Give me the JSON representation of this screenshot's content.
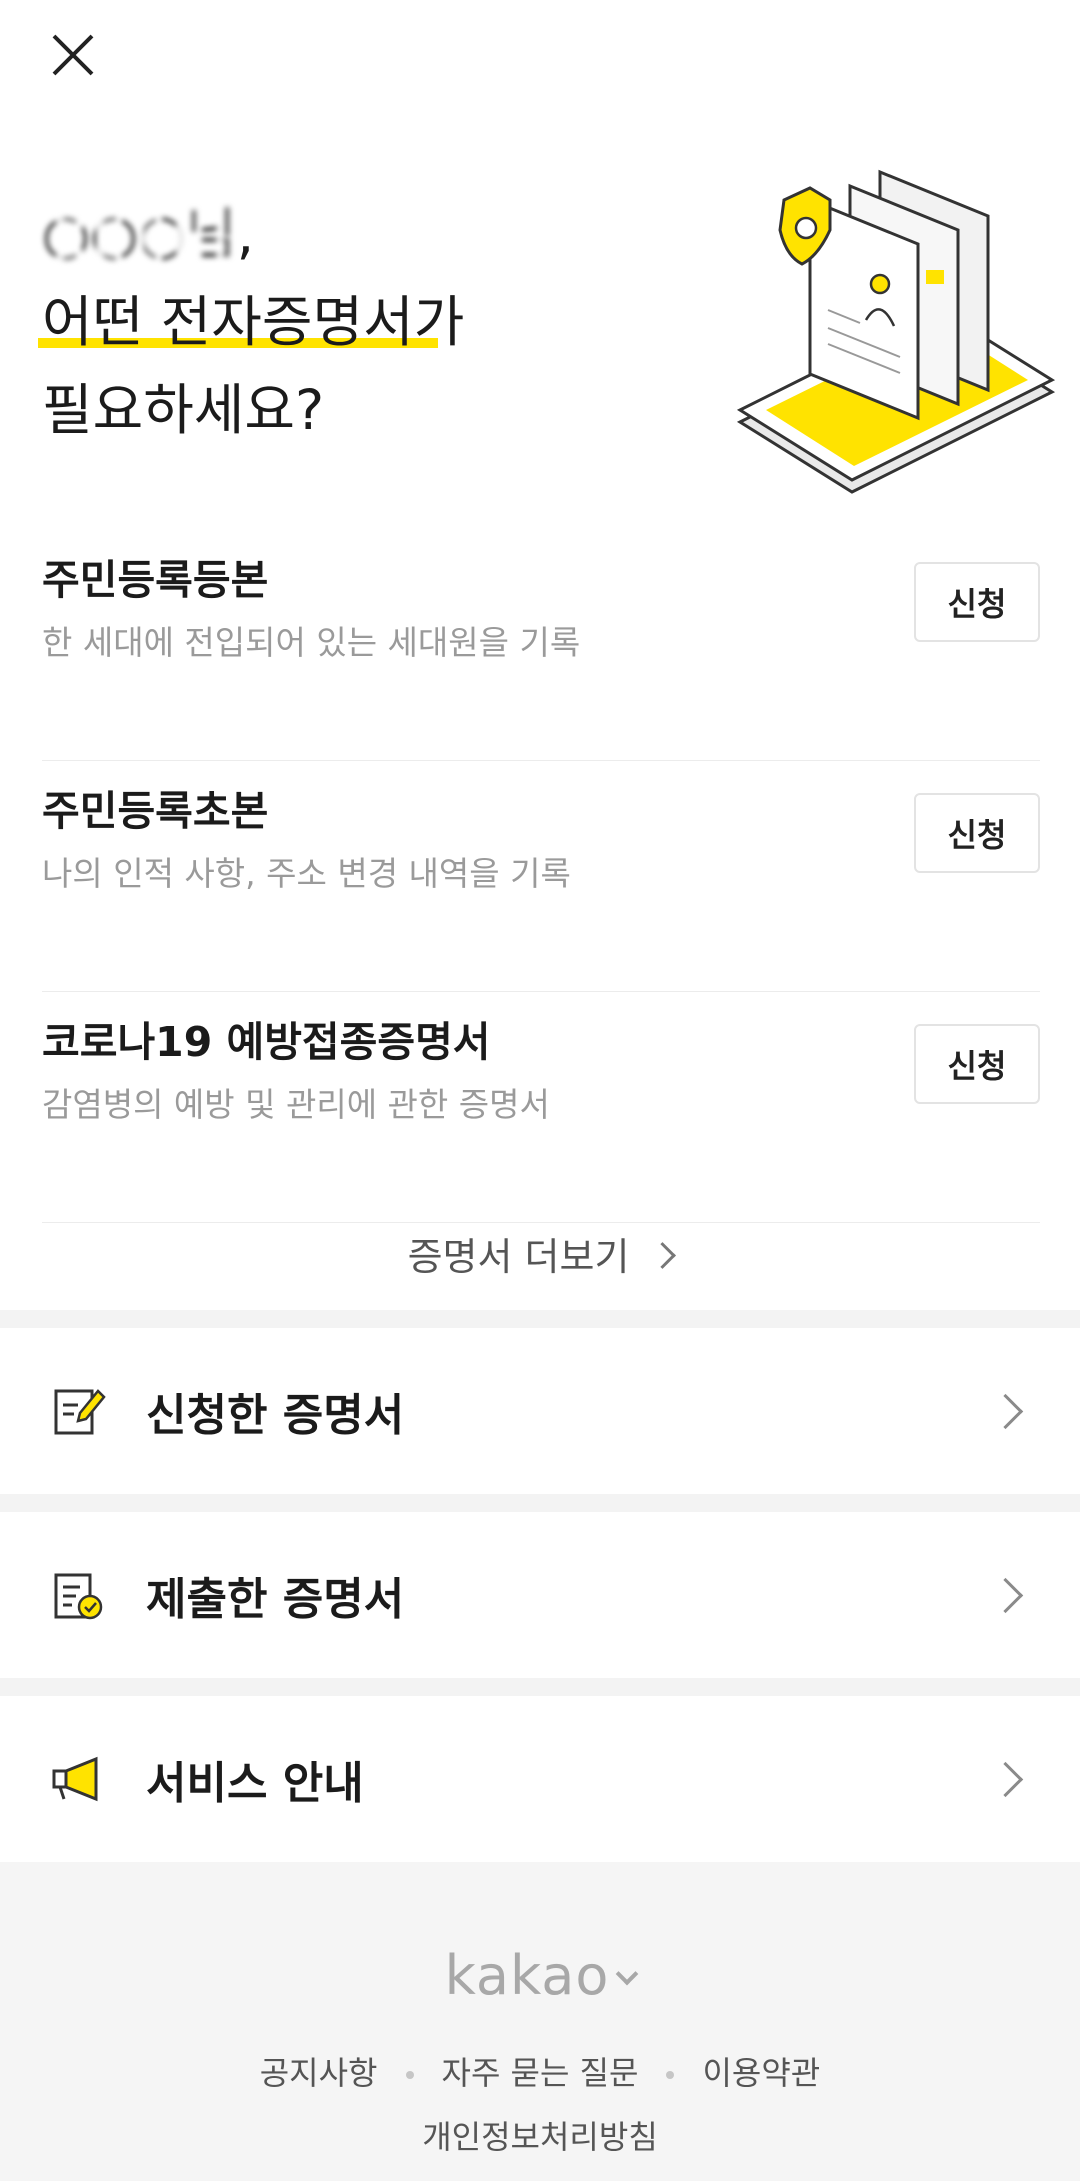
{
  "header": {
    "close_icon": "close-icon"
  },
  "hero": {
    "name_masked": "○○○님",
    "name_suffix": ",",
    "line2_highlight": "어떤 전자증명서",
    "line2_rest": "가",
    "line3": "필요하세요?"
  },
  "certificates": [
    {
      "title": "주민등록등본",
      "desc": "한 세대에 전입되어 있는 세대원을 기록",
      "button": "신청"
    },
    {
      "title": "주민등록초본",
      "desc": "나의 인적 사항, 주소 변경 내역을 기록",
      "button": "신청"
    },
    {
      "title": "코로나19 예방접종증명서",
      "desc": "감염병의 예방 및 관리에 관한 증명서",
      "button": "신청"
    }
  ],
  "more": {
    "label": "증명서 더보기"
  },
  "menu": [
    {
      "label": "신청한 증명서",
      "icon": "edit-document-icon"
    },
    {
      "label": "제출한 증명서",
      "icon": "checked-document-icon"
    },
    {
      "label": "서비스 안내",
      "icon": "megaphone-icon"
    }
  ],
  "footer": {
    "brand": "kakao",
    "links": [
      "공지사항",
      "자주 묻는 질문",
      "이용약관"
    ],
    "privacy": "개인정보처리방침"
  },
  "colors": {
    "accent": "#ffe300",
    "divider": "#f3f3f3",
    "footer_bg": "#f5f5f5"
  }
}
